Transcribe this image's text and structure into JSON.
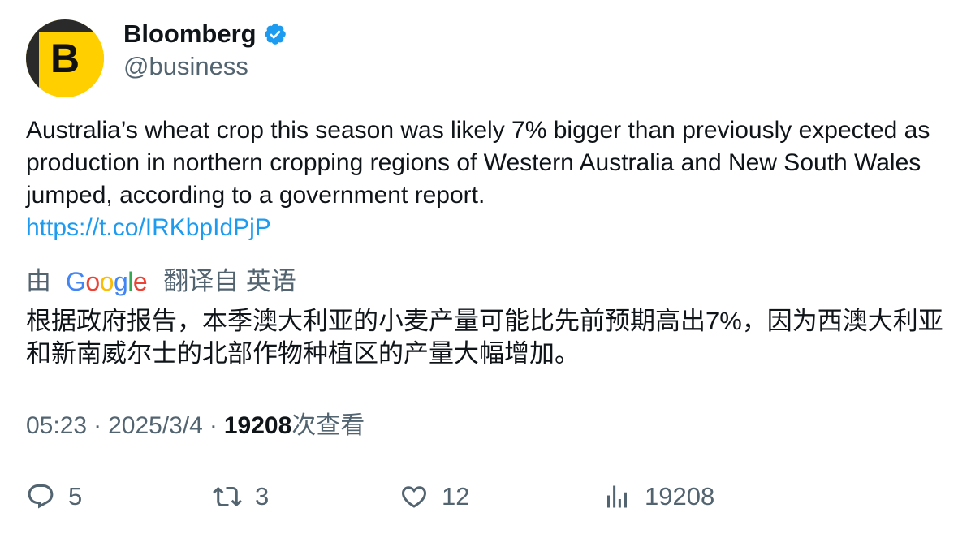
{
  "author": {
    "avatar_letter": "B",
    "name": "Bloomberg",
    "handle": "@business",
    "verified_color": "#1d9bf0"
  },
  "tweet": {
    "text": "Australia’s wheat crop this season was likely 7% bigger than previously expected as production in northern cropping regions of Western Australia and New South Wales jumped, according to a government report.",
    "link": "https://t.co/IRKbpIdPjP"
  },
  "translation": {
    "prefix": "由",
    "provider": "Google",
    "suffix": "翻译自 英语",
    "text": "根据政府报告，本季澳大利亚的小麦产量可能比先前预期高出7%，因为西澳大利亚和新南威尔士的北部作物种植区的产量大幅增加。"
  },
  "meta": {
    "time": "05:23",
    "date": "2025/3/4",
    "views": "19208",
    "views_label": "次查看"
  },
  "actions": {
    "replies": "5",
    "retweets": "3",
    "likes": "12",
    "views": "19208"
  },
  "colors": {
    "text": "#0f1419",
    "secondary": "#536471",
    "link": "#1d9bf0",
    "avatar_bg": "#ffcf00"
  }
}
